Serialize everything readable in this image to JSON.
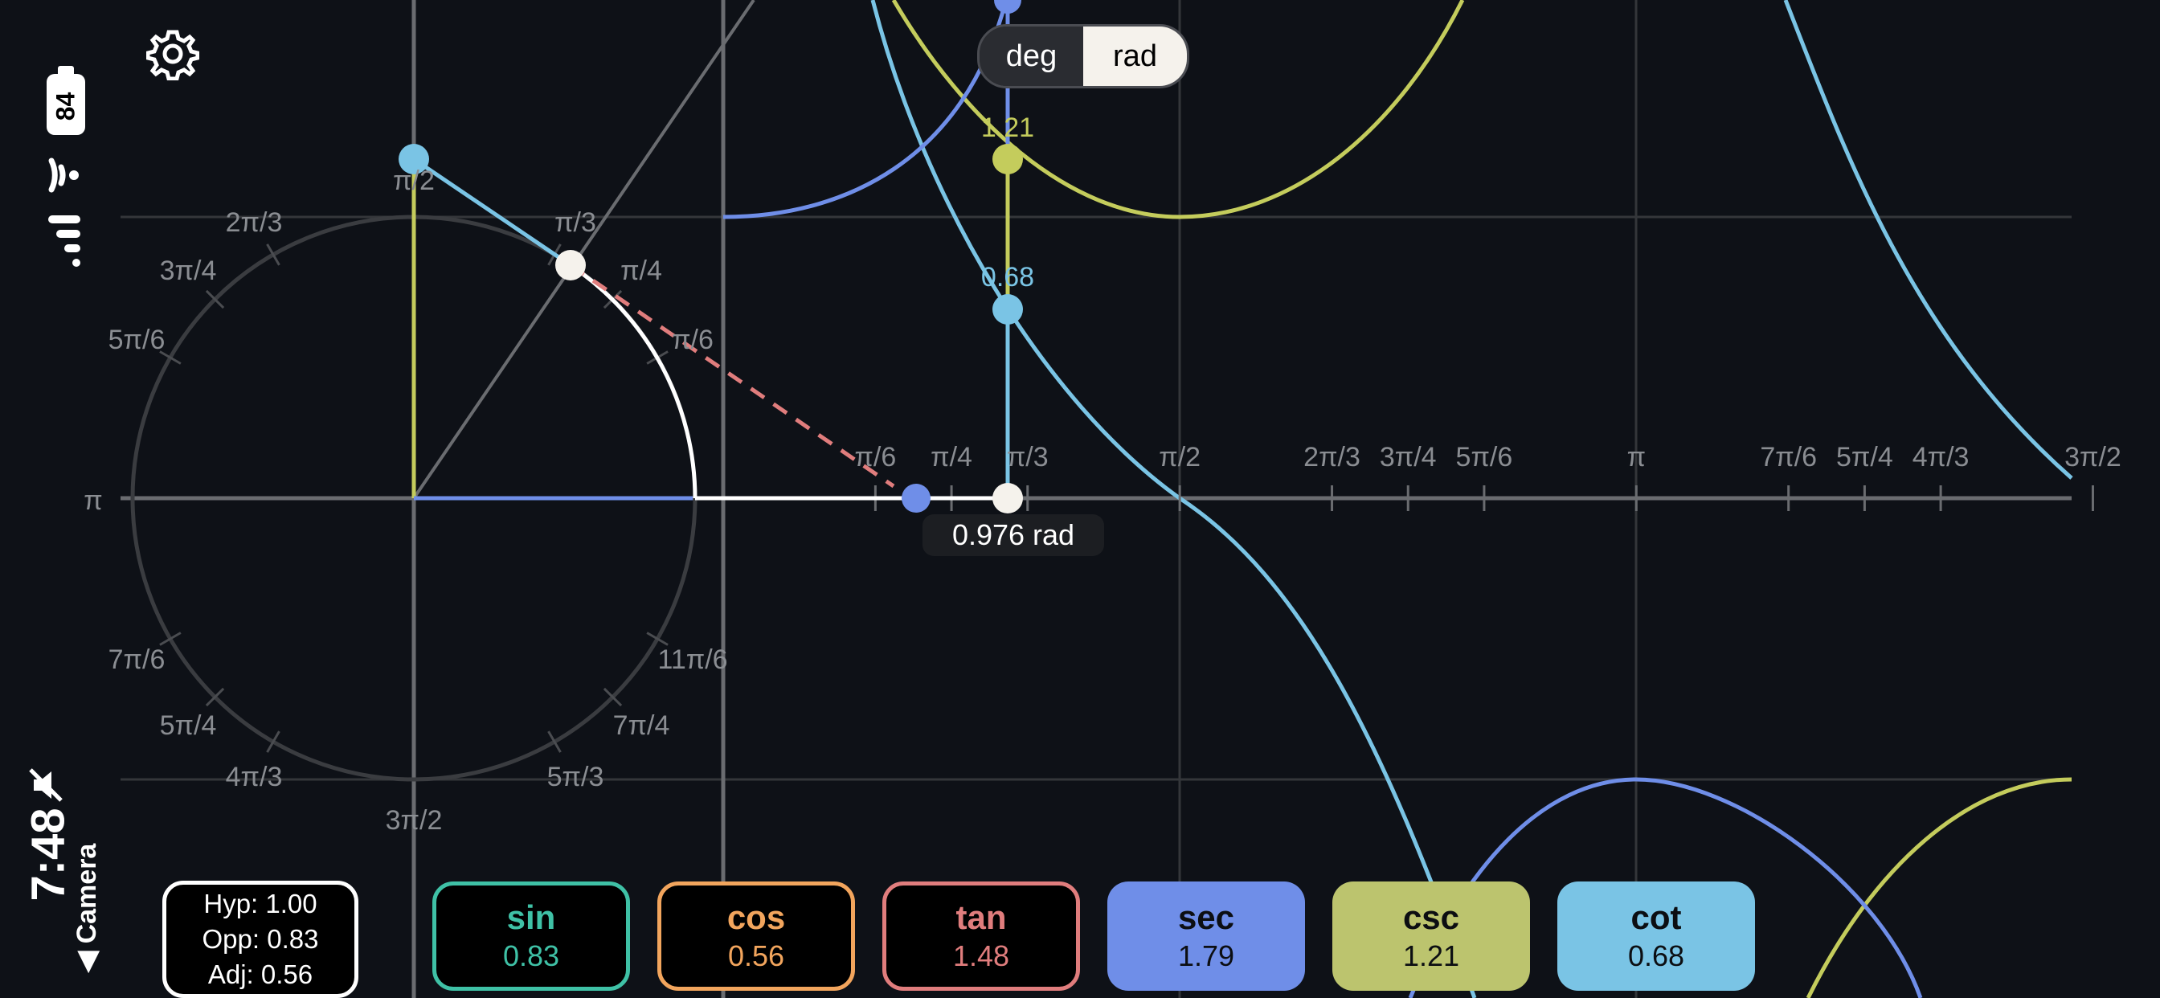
{
  "status_bar": {
    "battery": "84",
    "time": "7:48",
    "camera_label": "Camera"
  },
  "settings": {
    "icon": "gear-icon"
  },
  "unit_toggle": {
    "options": [
      "deg",
      "rad"
    ],
    "selected": "rad"
  },
  "angle": {
    "readout": "0.976 rad"
  },
  "triangle": {
    "hyp": "Hyp: 1.00",
    "opp": "Opp: 0.83",
    "adj": "Adj: 0.56"
  },
  "functions": [
    {
      "name": "sin",
      "value": "0.83",
      "style": "outlined",
      "color": "#3fc1a6"
    },
    {
      "name": "cos",
      "value": "0.56",
      "style": "outlined",
      "color": "#f2a55d"
    },
    {
      "name": "tan",
      "value": "1.48",
      "style": "outlined",
      "color": "#e07d7d"
    },
    {
      "name": "sec",
      "value": "1.79",
      "style": "filled",
      "color": "#6f8ee8"
    },
    {
      "name": "csc",
      "value": "1.21",
      "style": "filled",
      "color": "#bcc46e"
    },
    {
      "name": "cot",
      "value": "0.68",
      "style": "filled",
      "color": "#7ac4e5"
    }
  ],
  "circle_labels": [
    "π/2",
    "2π/3",
    "π/3",
    "3π/4",
    "π/4",
    "5π/6",
    "π/6",
    "π",
    "7π/6",
    "11π/6",
    "5π/4",
    "7π/4",
    "4π/3",
    "5π/3",
    "3π/2"
  ],
  "axis_labels": [
    "π/6",
    "π/4",
    "π/3",
    "π/2",
    "2π/3",
    "3π/4",
    "5π/6",
    "π",
    "7π/6",
    "5π/4",
    "4π/3",
    "3π/2"
  ],
  "point_labels": {
    "csc": "1.21",
    "cot": "0.68"
  },
  "colors": {
    "background": "#0e1117",
    "sin": "#c4cc5c",
    "cos": "#6f8ee8",
    "tan": "#e07d7d",
    "cot": "#7ac4e5",
    "grid": "#3a3c40"
  }
}
